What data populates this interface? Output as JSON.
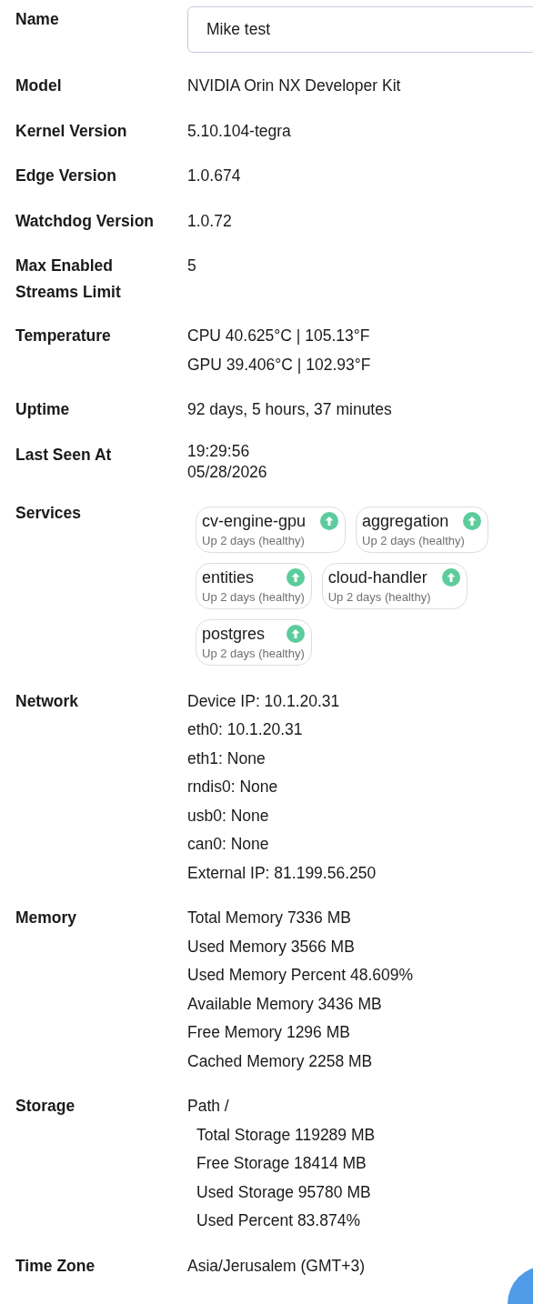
{
  "fields": [
    {
      "label": "Name",
      "kind": "input",
      "value": "Mike test"
    },
    {
      "label": "Model",
      "kind": "text",
      "lines": [
        "NVIDIA Orin NX Developer Kit"
      ]
    },
    {
      "label": "Kernel Version",
      "kind": "text",
      "lines": [
        "5.10.104-tegra"
      ]
    },
    {
      "label": "Edge Version",
      "kind": "text",
      "lines": [
        "1.0.674"
      ]
    },
    {
      "label": "Watchdog Version",
      "kind": "text",
      "lines": [
        "1.0.72"
      ]
    },
    {
      "label": "Max Enabled Streams Limit",
      "kind": "text",
      "lines": [
        "5"
      ]
    },
    {
      "label": "Temperature",
      "kind": "text",
      "lines": [
        "CPU 40.625°C | 105.13°F",
        "GPU 39.406°C | 102.93°F"
      ]
    },
    {
      "label": "Uptime",
      "kind": "text",
      "lines": [
        "92 days, 5 hours, 37 minutes"
      ]
    },
    {
      "label": "Last Seen At",
      "kind": "compact",
      "lines": [
        "19:29:56",
        "05/28/2026"
      ]
    },
    {
      "label": "Services",
      "kind": "services",
      "services": [
        {
          "name": "cv-engine-gpu",
          "status": "Up 2 days (healthy)",
          "running": true
        },
        {
          "name": "aggregation",
          "status": "Up 2 days (healthy)",
          "running": true
        },
        {
          "name": "entities",
          "status": "Up 2 days (healthy)",
          "running": true
        },
        {
          "name": "cloud-handler",
          "status": "Up 2 days (healthy)",
          "running": true
        },
        {
          "name": "postgres",
          "status": "Up 2 days (healthy)",
          "running": true
        }
      ]
    },
    {
      "label": "Network",
      "kind": "text",
      "lines": [
        "Device IP: 10.1.20.31",
        "eth0: 10.1.20.31",
        "eth1: None",
        "rndis0: None",
        "usb0: None",
        "can0: None",
        "External IP: 81.199.56.250"
      ]
    },
    {
      "label": "Memory",
      "kind": "text",
      "lines": [
        "Total Memory 7336 MB",
        "Used Memory 3566 MB",
        "Used Memory Percent 48.609%",
        "Available Memory 3436 MB",
        "Free Memory 1296 MB",
        "Cached Memory 2258 MB"
      ]
    },
    {
      "label": "Storage",
      "kind": "storage",
      "path": "Path /",
      "lines": [
        "Total Storage 119289 MB",
        "Free Storage 18414 MB",
        "Used Storage 95780 MB",
        "Used Percent 83.874%"
      ]
    },
    {
      "label": "Time Zone",
      "kind": "text",
      "lines": [
        "Asia/Jerusalem (GMT+3)"
      ]
    }
  ]
}
